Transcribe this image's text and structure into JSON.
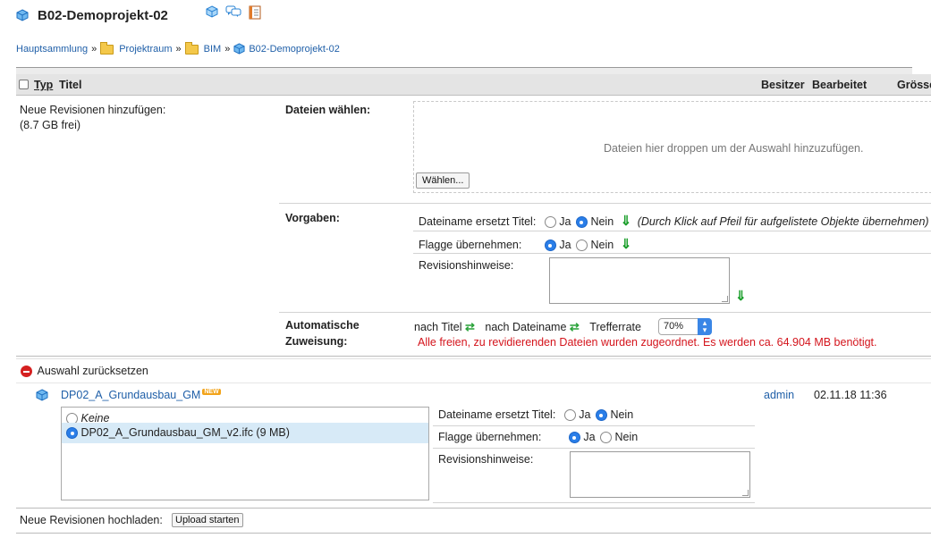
{
  "header": {
    "title": "B02-Demoprojekt-02",
    "icons": [
      "cube-icon",
      "comments-icon",
      "notes-icon"
    ]
  },
  "breadcrumb": {
    "items": [
      "Hauptsammlung",
      "Projektraum",
      "BIM",
      "B02-Demoprojekt-02"
    ],
    "separator": "»"
  },
  "table": {
    "columns": {
      "typ": "Typ",
      "titel": "Titel",
      "besitzer": "Besitzer",
      "bearbeitet": "Bearbeitet",
      "groesse": "Grösse"
    }
  },
  "upload": {
    "left_label": "Neue Revisionen hinzufügen:",
    "free_space": "(8.7 GB frei)",
    "files_label": "Dateien wählen:",
    "drop_hint": "Dateien hier droppen um der Auswahl hinzuzufügen.",
    "choose_button": "Wählen...",
    "defaults_label": "Vorgaben:",
    "filename_replaces_title": "Dateiname ersetzt Titel:",
    "yes": "Ja",
    "no": "Nein",
    "arrow_hint": "(Durch Klick auf Pfeil für aufgelistete Objekte übernehmen)",
    "adopt_flag": "Flagge übernehmen:",
    "revision_notes": "Revisionshinweise:",
    "auto_assign_label_1": "Automatische",
    "auto_assign_label_2": "Zuweisung:",
    "by_title": "nach Titel",
    "by_filename": "nach Dateiname",
    "hit_rate_label": "Trefferrate",
    "hit_rate_value": "70%",
    "status_message": "Alle freien, zu revidierenden Dateien wurden zugeordnet. Es werden ca. 64.904 MB benötigt."
  },
  "reset": {
    "label": "Auswahl zurücksetzen"
  },
  "object": {
    "name": "DP02_A_Grundausbau_GM",
    "badge": "NEW",
    "owner": "admin",
    "modified": "02.11.18 11:36",
    "options": [
      {
        "label": "Keine",
        "selected": false
      },
      {
        "label": "DP02_A_Grundausbau_GM_v2.ifc (9 MB)",
        "selected": true
      }
    ],
    "filename_replaces_title": "Dateiname ersetzt Titel:",
    "yes": "Ja",
    "no": "Nein",
    "adopt_flag": "Flagge übernehmen:",
    "revision_notes": "Revisionshinweise:"
  },
  "footer": {
    "label": "Neue Revisionen hochladen:",
    "button": "Upload starten"
  },
  "colors": {
    "link": "#1f5fa8",
    "error": "#d4141c",
    "radio_on": "#2a7ee8",
    "arrow": "#1a9e2a"
  }
}
